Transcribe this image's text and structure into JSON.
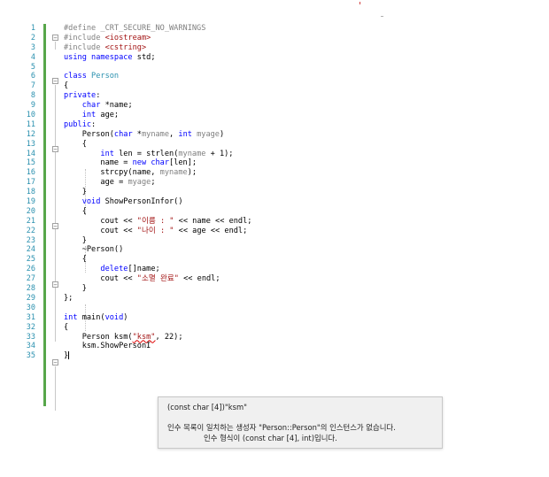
{
  "editor": {
    "line_numbers": [
      "1",
      "2",
      "3",
      "4",
      "5",
      "6",
      "7",
      "8",
      "9",
      "10",
      "11",
      "12",
      "13",
      "14",
      "15",
      "16",
      "17",
      "18",
      "19",
      "20",
      "21",
      "22",
      "23",
      "24",
      "25",
      "26",
      "27",
      "28",
      "29",
      "30",
      "31",
      "32",
      "33",
      "34",
      "35"
    ],
    "lines": [
      [
        {
          "t": "#define _CRT_SECURE_NO_WARNINGS",
          "c": "pp"
        }
      ],
      [
        {
          "t": "#include ",
          "c": "pp"
        },
        {
          "t": "<iostream>",
          "c": "inc"
        }
      ],
      [
        {
          "t": "#include ",
          "c": "pp"
        },
        {
          "t": "<cstring>",
          "c": "inc"
        }
      ],
      [
        {
          "t": "using namespace ",
          "c": "kw"
        },
        {
          "t": "std;",
          "c": ""
        }
      ],
      [],
      [
        {
          "t": "class ",
          "c": "kw"
        },
        {
          "t": "Person",
          "c": "ty"
        }
      ],
      [
        {
          "t": "{",
          "c": ""
        }
      ],
      [
        {
          "t": "private",
          "c": "kw"
        },
        {
          "t": ":",
          "c": ""
        }
      ],
      [
        {
          "t": "    ",
          "c": ""
        },
        {
          "t": "char ",
          "c": "kw"
        },
        {
          "t": "*name;",
          "c": ""
        }
      ],
      [
        {
          "t": "    ",
          "c": ""
        },
        {
          "t": "int ",
          "c": "kw"
        },
        {
          "t": "age;",
          "c": ""
        }
      ],
      [
        {
          "t": "public",
          "c": "kw"
        },
        {
          "t": ":",
          "c": ""
        }
      ],
      [
        {
          "t": "    Person(",
          "c": ""
        },
        {
          "t": "char ",
          "c": "kw"
        },
        {
          "t": "*",
          "c": ""
        },
        {
          "t": "myname",
          "c": "param"
        },
        {
          "t": ", ",
          "c": ""
        },
        {
          "t": "int ",
          "c": "kw"
        },
        {
          "t": "myage",
          "c": "param"
        },
        {
          "t": ")",
          "c": ""
        }
      ],
      [
        {
          "t": "    {",
          "c": ""
        }
      ],
      [
        {
          "t": "        ",
          "c": ""
        },
        {
          "t": "int ",
          "c": "kw"
        },
        {
          "t": "len = strlen(",
          "c": ""
        },
        {
          "t": "myname",
          "c": "param"
        },
        {
          "t": " + 1);",
          "c": ""
        }
      ],
      [
        {
          "t": "        name = ",
          "c": ""
        },
        {
          "t": "new ",
          "c": "kw"
        },
        {
          "t": "char",
          "c": "kw"
        },
        {
          "t": "[len];",
          "c": ""
        }
      ],
      [
        {
          "t": "        strcpy(name, ",
          "c": ""
        },
        {
          "t": "myname",
          "c": "param"
        },
        {
          "t": ");",
          "c": ""
        }
      ],
      [
        {
          "t": "        age = ",
          "c": ""
        },
        {
          "t": "myage",
          "c": "param"
        },
        {
          "t": ";",
          "c": ""
        }
      ],
      [
        {
          "t": "    }",
          "c": ""
        }
      ],
      [
        {
          "t": "    ",
          "c": ""
        },
        {
          "t": "void ",
          "c": "kw"
        },
        {
          "t": "ShowPersonInfor()",
          "c": ""
        }
      ],
      [
        {
          "t": "    {",
          "c": ""
        }
      ],
      [
        {
          "t": "        cout << ",
          "c": ""
        },
        {
          "t": "\"이름 : \"",
          "c": "str"
        },
        {
          "t": " << name << endl;",
          "c": ""
        }
      ],
      [
        {
          "t": "        cout << ",
          "c": ""
        },
        {
          "t": "\"나이 : \"",
          "c": "str"
        },
        {
          "t": " << age << endl;",
          "c": ""
        }
      ],
      [
        {
          "t": "    }",
          "c": ""
        }
      ],
      [
        {
          "t": "    ~Person()",
          "c": ""
        }
      ],
      [
        {
          "t": "    {",
          "c": ""
        }
      ],
      [
        {
          "t": "        ",
          "c": ""
        },
        {
          "t": "delete",
          "c": "kw"
        },
        {
          "t": "[]name;",
          "c": ""
        }
      ],
      [
        {
          "t": "        cout << ",
          "c": ""
        },
        {
          "t": "\"소멸 완료\"",
          "c": "str"
        },
        {
          "t": " << endl;",
          "c": ""
        }
      ],
      [
        {
          "t": "    }",
          "c": ""
        }
      ],
      [
        {
          "t": "};",
          "c": ""
        }
      ],
      [],
      [
        {
          "t": "int ",
          "c": "kw"
        },
        {
          "t": "main(",
          "c": ""
        },
        {
          "t": "void",
          "c": "kw"
        },
        {
          "t": ")",
          "c": ""
        }
      ],
      [
        {
          "t": "{",
          "c": ""
        }
      ],
      [
        {
          "t": "    Person ksm(",
          "c": ""
        },
        {
          "t": "\"ksm\"",
          "c": "str",
          "sq": true
        },
        {
          "t": ", 22);",
          "c": ""
        }
      ],
      [
        {
          "t": "    ksm.ShowPersonI",
          "c": ""
        }
      ],
      [
        {
          "t": "}",
          "c": ""
        }
      ]
    ]
  },
  "tooltip": {
    "signature": "(const char [4])\"ksm\"",
    "message_line1": "인수 목록이 일치하는 생성자 \"Person::Person\"의 인스턴스가 없습니다.",
    "message_line2": "인수 형식이 (const char [4], int)입니다."
  }
}
